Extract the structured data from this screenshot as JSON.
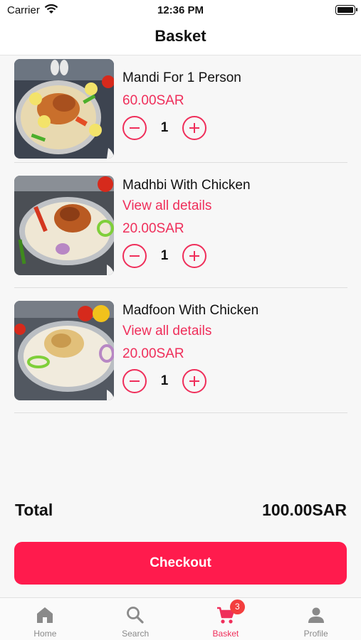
{
  "status_bar": {
    "carrier": "Carrier",
    "time": "12:36 PM"
  },
  "header": {
    "title": "Basket"
  },
  "items": [
    {
      "name": "Mandi For 1 Person",
      "details_link": "",
      "price": "60.00SAR",
      "quantity": "1"
    },
    {
      "name": "Madhbi With Chicken",
      "details_link": "View all details",
      "price": "20.00SAR",
      "quantity": "1"
    },
    {
      "name": "Madfoon With Chicken",
      "details_link": "View all details",
      "price": "20.00SAR",
      "quantity": "1"
    }
  ],
  "summary": {
    "total_label": "Total",
    "total_value": "100.00SAR"
  },
  "checkout_label": "Checkout",
  "tab_bar": {
    "tabs": [
      {
        "label": "Home",
        "icon": "home-icon"
      },
      {
        "label": "Search",
        "icon": "search-icon"
      },
      {
        "label": "Basket",
        "icon": "cart-icon",
        "badge": "3",
        "active": true
      },
      {
        "label": "Profile",
        "icon": "person-icon"
      }
    ]
  },
  "colors": {
    "accent": "#ef2e5a",
    "checkout": "#ff1b4d",
    "badge": "#f33e3e"
  }
}
